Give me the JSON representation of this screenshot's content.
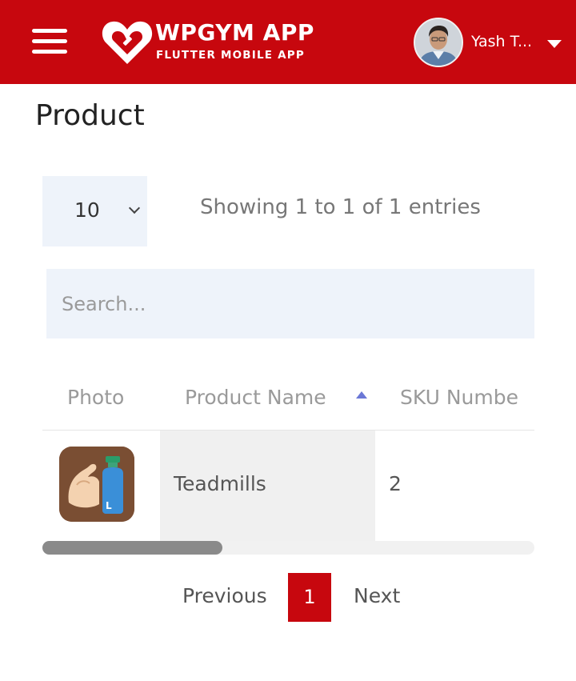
{
  "header": {
    "logo_title": "WPGYM APP",
    "logo_subtitle": "FLUTTER MOBILE APP",
    "user_name": "Yash T..."
  },
  "page": {
    "title": "Product"
  },
  "controls": {
    "page_length": "10",
    "entries_info": "Showing 1 to 1 of 1 entries",
    "search_placeholder": "Search..."
  },
  "table": {
    "columns": [
      "Photo",
      "Product Name",
      "SKU Numbe"
    ],
    "sorted_column": "Product Name",
    "rows": [
      {
        "photo_icon": "muscle-bottle-icon",
        "product_name": "Teadmills",
        "sku_number": "2"
      }
    ]
  },
  "pagination": {
    "previous_label": "Previous",
    "current_page": "1",
    "next_label": "Next"
  },
  "colors": {
    "brand": "#c7070e",
    "field_bg": "#eef3fa",
    "sort_indicator": "#6b78d6"
  }
}
